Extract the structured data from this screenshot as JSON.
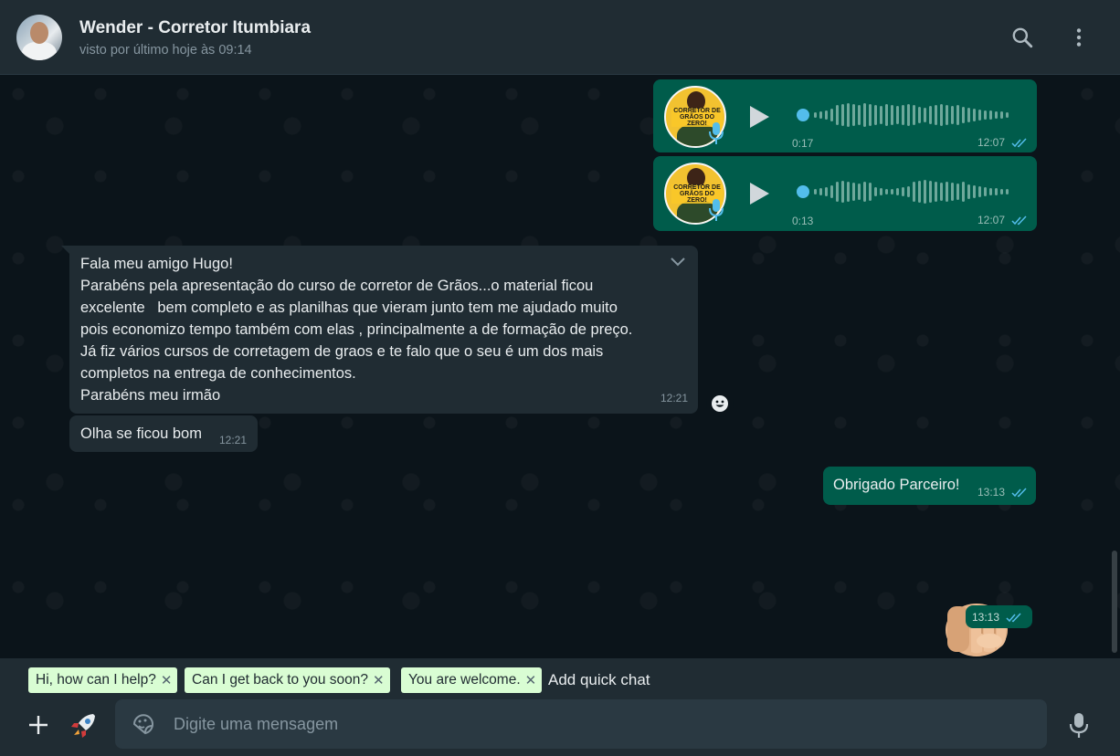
{
  "header": {
    "name": "Wender - Corretor Itumbiara",
    "status": "visto por último hoje às 09:14",
    "search_icon": "search-icon",
    "menu_icon": "kebab-menu-icon"
  },
  "messages": {
    "audio1": {
      "duration": "0:17",
      "time": "12:07",
      "art_text": "CORRETOR DE GRÃOS DO ZERO!"
    },
    "audio2": {
      "duration": "0:13",
      "time": "12:07",
      "art_text": "CORRETOR DE GRÃOS DO ZERO!"
    },
    "incoming1": {
      "lines": [
        "Fala meu amigo Hugo!",
        "Parabéns pela apresentação do curso de corretor de Grãos...o material ficou",
        "excelente   bem completo e as planilhas que vieram junto tem me ajudado muito",
        "pois economizo tempo também com elas , principalmente a de formação de preço.",
        "Já fiz vários cursos de corretagem de graos e te falo que o seu é um dos mais",
        "completos na entrega de conhecimentos.",
        "Parabéns meu irmão"
      ],
      "time": "12:21"
    },
    "incoming2": {
      "text": "Olha se ficou bom",
      "time": "12:21"
    },
    "outgoing1": {
      "text": "Obrigado Parceiro!",
      "time": "13:13"
    },
    "sticker": {
      "icon": "fist-bump-emoji",
      "time": "13:13"
    }
  },
  "quick_chats": {
    "chips": [
      "Hi, how can I help?",
      "Can I get back to you soon?",
      "You are welcome."
    ],
    "remove_glyph": "✕",
    "add_label": "Add quick chat"
  },
  "composer": {
    "placeholder": "Digite uma mensagem"
  },
  "colors": {
    "outgoing_bubble": "#005c4b",
    "incoming_bubble": "#202c33",
    "background": "#0b141a",
    "tick_read": "#53bdeb"
  }
}
